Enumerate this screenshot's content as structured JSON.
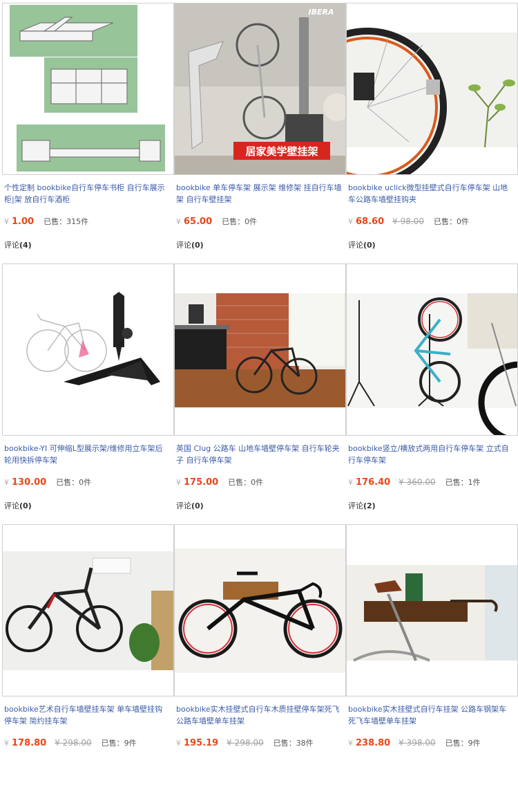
{
  "currency_symbol": "¥",
  "sold_label": "已售：",
  "review_label": "评论",
  "products": [
    {
      "title": "个性定制 bookbike自行车停车书柜 自行车展示柜|架 放自行车酒柜",
      "price": "1.00",
      "orig": "",
      "sold": "315件",
      "reviews": "(4)",
      "image": "bookshelf-drawing"
    },
    {
      "title": "bookbike 单车停车架 展示架 维修架 挂自行车墙架 自行车壁挂架",
      "price": "65.00",
      "orig": "",
      "sold": "0件",
      "reviews": "(0)",
      "image": "wall-hook-photo",
      "overlay": "居家美学壁挂架",
      "brand": "IBERA"
    },
    {
      "title": "bookbike uclick微型挂壁式自行车停车架 山地车公路车墙壁挂钩夹",
      "price": "68.60",
      "orig": "98.00",
      "sold": "0件",
      "reviews": "(0)",
      "image": "wheel-clip-photo"
    },
    {
      "title": "bookbike-YI 可伸缩L型展示架/维修用立车架后轮用快拆停车架",
      "price": "130.00",
      "orig": "",
      "sold": "0件",
      "reviews": "(0)",
      "image": "l-stand"
    },
    {
      "title": "英国 Clug 公路车 山地车墙壁停车架 自行车轮夹子 自行车停车架",
      "price": "175.00",
      "orig": "",
      "sold": "0件",
      "reviews": "(0)",
      "image": "clug-room"
    },
    {
      "title": "bookbike竖立/横放式两用自行车停车架 立式自行车停车架",
      "price": "176.40",
      "orig": "360.00",
      "sold": "1件",
      "reviews": "(2)",
      "image": "vertical-stand"
    },
    {
      "title": "bookbike艺术自行车墙壁挂车架 单车墙壁挂钩 停车架 简约挂车架",
      "price": "178.80",
      "orig": "298.00",
      "sold": "9件",
      "reviews": "",
      "image": "wall-bike-1"
    },
    {
      "title": "bookbike实木挂壁式自行车木质挂壁停车架死飞公路车墙壁单车挂架",
      "price": "195.19",
      "orig": "298.00",
      "sold": "38件",
      "reviews": "",
      "image": "wood-shelf-bike"
    },
    {
      "title": "bookbike实木挂壁式自行车挂架 公路车钢架车 死飞车墙壁单车挂架",
      "price": "238.80",
      "orig": "398.00",
      "sold": "9件",
      "reviews": "",
      "image": "wood-shelf-room"
    }
  ]
}
